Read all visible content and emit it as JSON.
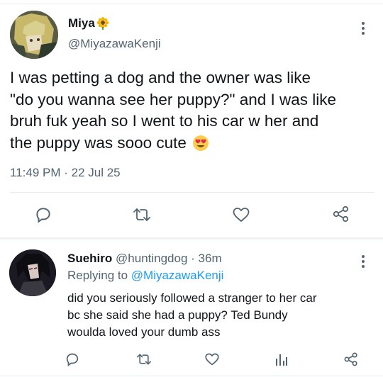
{
  "main_tweet": {
    "name": "Miya",
    "name_emoji": "sunflower",
    "handle": "@MiyazawaKenji",
    "text_lines": [
      "I was petting a dog and the owner was like",
      "\"do you wanna see her puppy?\" and I was like",
      "bruh fuk yeah so I went to his car w her and",
      "the puppy was sooo cute"
    ],
    "text_emoji": "heart-eyes",
    "timestamp": "11:49 PM · 22 Jul 25",
    "actions": [
      "reply-icon",
      "retweet-icon",
      "like-icon",
      "share-icon"
    ]
  },
  "reply_tweet": {
    "name": "Suehiro",
    "handle": "@huntingdog",
    "time": "· 36m",
    "replying_prefix": "Replying to ",
    "replying_to": "@MiyazawaKenji",
    "text_lines": [
      "did you seriously followed a stranger to her car",
      "bc she said she had a puppy? Ted Bundy",
      "woulda loved your dumb ass"
    ],
    "actions": [
      "reply-icon",
      "retweet-icon",
      "like-icon",
      "analytics-icon",
      "share-icon"
    ]
  },
  "colors": {
    "text": "#0f1419",
    "muted": "#536471",
    "link": "#1d9bf0",
    "divider": "#e6ecf0"
  }
}
